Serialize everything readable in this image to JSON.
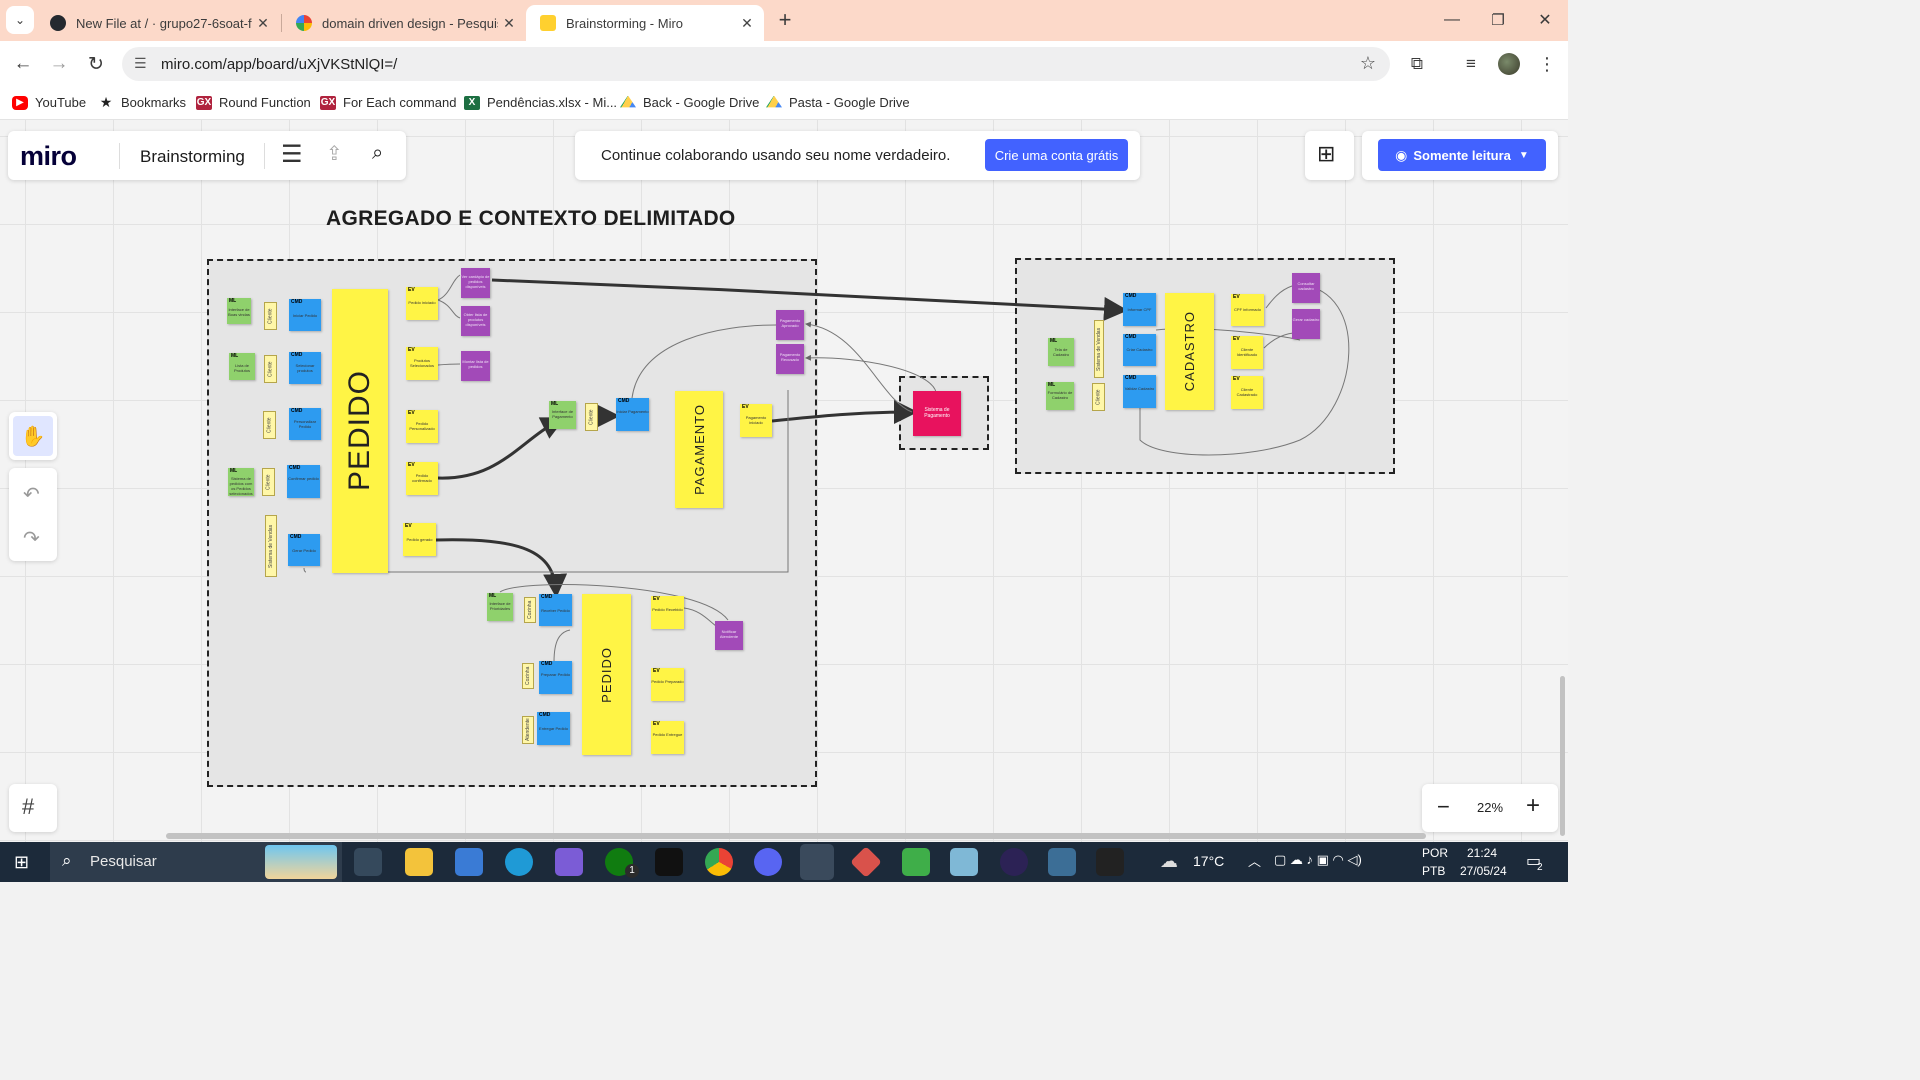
{
  "browser": {
    "tabs": [
      {
        "title": "New File at / · grupo27-6soat-fi",
        "favicon_color": "#24292f"
      },
      {
        "title": "domain driven design - Pesquis",
        "favicon_color": "#4285f4"
      },
      {
        "title": "Brainstorming - Miro",
        "favicon_color": "#ffd02f"
      }
    ],
    "tab_close": "✕",
    "new_tab": "+",
    "url": "miro.com/app/board/uXjVKStNlQI=/",
    "bookmarks": [
      {
        "label": "YouTube",
        "icon": "youtube-icon",
        "color": "#ff0000"
      },
      {
        "label": "Bookmarks",
        "icon": "star-icon",
        "color": "#333333"
      },
      {
        "label": "Round Function",
        "icon": "genexus-icon",
        "color": "#b0233e"
      },
      {
        "label": "For Each command",
        "icon": "genexus-icon",
        "color": "#b0233e"
      },
      {
        "label": "Pendências.xlsx - Mi...",
        "icon": "excel-icon",
        "color": "#1d6f42"
      },
      {
        "label": "Back - Google Drive",
        "icon": "drive-icon",
        "color": "#1fa463"
      },
      {
        "label": "Pasta - Google Drive",
        "icon": "drive-icon",
        "color": "#1fa463"
      }
    ]
  },
  "miro": {
    "logo": "miro",
    "board_name": "Brainstorming",
    "banner_text": "Continue colaborando usando seu nome verdadeiro.",
    "banner_button": "Crie uma conta grátis",
    "readonly_button": "Somente leitura",
    "zoom": "22%",
    "zoom_minus": "−",
    "zoom_plus": "+",
    "accent": "#4262ff"
  },
  "board": {
    "title": "AGREGADO E CONTEXTO DELIMITADO",
    "aggregates": {
      "pedido_main": "PEDIDO",
      "pagamento": "PAGAMENTO",
      "pedido_second": "PEDIDO",
      "cadastro": "CADASTRO"
    },
    "tags": {
      "ml": "ML",
      "cmd": "CMD",
      "ev": "EV"
    },
    "external_system": "Sistema de Pagamento",
    "notes": {
      "ml1": "Interface de Boas vindas",
      "ml2": "Lista de Produtos",
      "ml3": "Sistema de pedidos com os Pedidos selecionados",
      "ml4": "Interface de Pagamento",
      "ml5": "Interface de Prioridades",
      "ml6": "Tela de Cadastro",
      "ml7": "Formulário de Cadastro",
      "actor_cliente": "Cliente",
      "actor_sistema": "Sistema de Vendas",
      "actor_cozinha": "Cozinha",
      "actor_atendente": "Atendente",
      "cmd_iniciar": "Iniciar Pedido",
      "cmd_selecionar": "Selecionar produtos",
      "cmd_personalizar": "Personalizar Pedido",
      "cmd_confirmar": "Confirmar pedido",
      "cmd_gerar": "Gerar Pedido",
      "cmd_pagamento": "Iniciar Pagamento",
      "cmd_receber": "Receber Pedido",
      "cmd_preparar": "Preparar Pedido",
      "cmd_entregar": "Entregar Pedido",
      "cmd_cpf": "Informar CPF",
      "cmd_cadastrar": "Criar Cadastro",
      "cmd_validar": "Validar Cadastro",
      "ev_iniciado": "Pedido iniciado",
      "ev_selecionados": "Produtos Selecionados",
      "ev_personalizado": "Pedido Personalizado",
      "ev_confirmado": "Pedido confirmado",
      "ev_gerado": "Pedido gerado",
      "ev_pag_iniciado": "Pagamento iniciado",
      "ev_recebido": "Pedido Recebido",
      "ev_preparado": "Pedido Preparado",
      "ev_entregue": "Pedido Entregue",
      "ev_cpf": "CPF informado",
      "ev_identificado": "Cliente Identificado",
      "ev_cadastrado": "Cliente Cadastrado",
      "p1": "Ver cardápio de pedidos disponíveis",
      "p2": "Obter lista de produtos disponíveis",
      "p3": "Montar lista de pedidos",
      "p4": "Pagamento Aprovado",
      "p5": "Pagamento Recusado",
      "p6": "Notificar Atendente",
      "p7": "Consultar cadastro",
      "p8": "Gerar cadastro"
    }
  },
  "taskbar": {
    "search": "Pesquisar",
    "temperature": "17°C",
    "lang1": "POR",
    "lang2": "PTB",
    "time": "21:24",
    "date": "27/05/24",
    "notifications": "2",
    "badge": "1"
  }
}
